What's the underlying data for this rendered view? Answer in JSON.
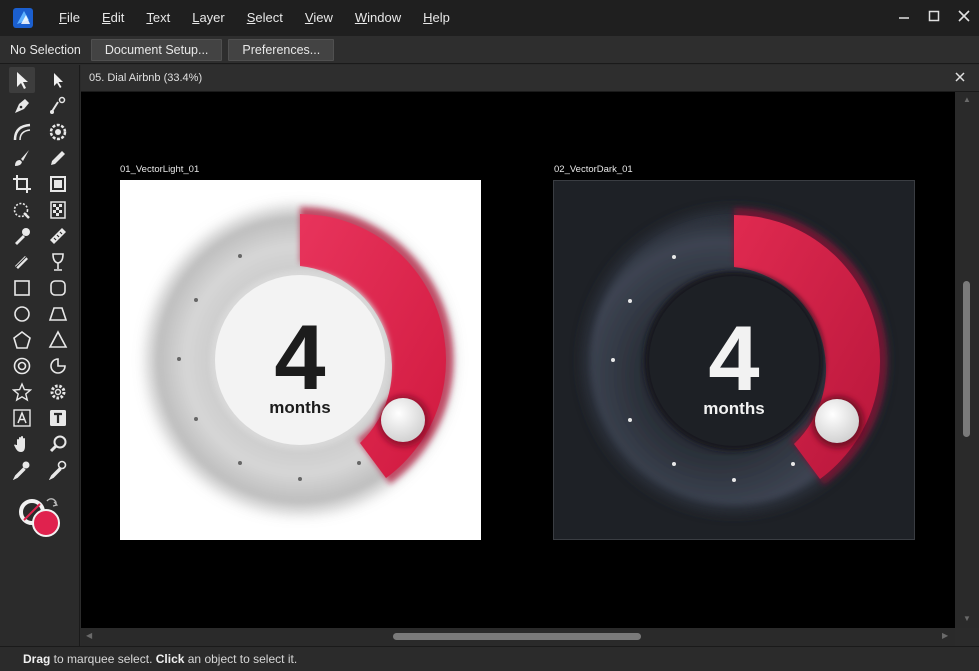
{
  "menu": {
    "items": [
      "File",
      "Edit",
      "Text",
      "Layer",
      "Select",
      "View",
      "Window",
      "Help"
    ]
  },
  "context": {
    "selection_label": "No Selection",
    "document_setup_label": "Document Setup...",
    "preferences_label": "Preferences..."
  },
  "document": {
    "tab_title": "05. Dial Airbnb (33.4%)"
  },
  "artboards": [
    {
      "name": "01_VectorLight_01",
      "number": "4",
      "unit": "months"
    },
    {
      "name": "02_VectorDark_01",
      "number": "4",
      "unit": "months"
    }
  ],
  "status": {
    "word1": "Drag",
    "text1": " to marquee select. ",
    "word2": "Click",
    "text2": " an object to select it."
  },
  "colors": {
    "accent_red": "#e0224e",
    "canvas": "#000000",
    "dark_artboard": "#1e2126",
    "light_artboard": "#ffffff"
  },
  "icons": {
    "app": "affinity-designer-logo",
    "minimize": "minimize-icon",
    "maximize": "maximize-icon",
    "close": "close-icon"
  }
}
